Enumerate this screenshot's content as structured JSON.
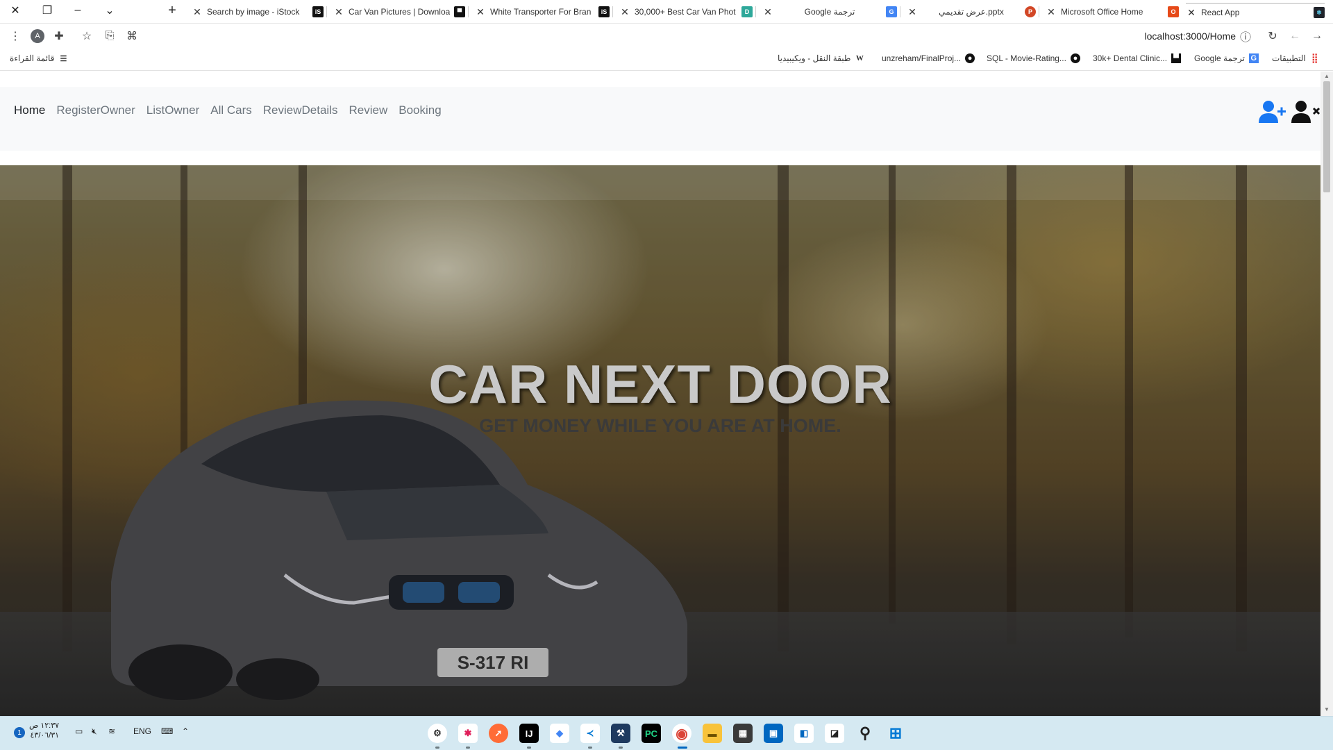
{
  "browser": {
    "tabs": [
      {
        "title": "React App",
        "favicon": "react-icon",
        "active": true
      },
      {
        "title": "Microsoft Office Home",
        "favicon": "office-icon"
      },
      {
        "title": "عرض تقديمي.pptx",
        "favicon": "powerpoint-icon"
      },
      {
        "title": "Google ترجمة",
        "favicon": "google-translate-icon"
      },
      {
        "title": "30,000+ Best Car Van Phot",
        "favicon": "d-icon"
      },
      {
        "title": "White Transporter For Bran",
        "favicon": "istock-icon"
      },
      {
        "title": "Car Van Pictures | Downloa",
        "favicon": "unsplash-icon"
      },
      {
        "title": "Search by image - iStock",
        "favicon": "istock-icon"
      }
    ],
    "new_tab_symbol": "+",
    "url": "localhost:3000/Home",
    "bookmarks": [
      {
        "label": "التطبيقات",
        "icon": "apps-grid-icon"
      },
      {
        "label": "Google ترجمة",
        "icon": "google-translate-icon"
      },
      {
        "label": "30k+ Dental Clinic...",
        "icon": "unsplash-icon"
      },
      {
        "label": "SQL - Movie-Rating...",
        "icon": "github-icon"
      },
      {
        "label": "unzreham/FinalProj...",
        "icon": "github-icon"
      },
      {
        "label": "طبقة النقل - ويكيبيديا",
        "icon": "wikipedia-icon"
      }
    ],
    "reading_list": "قائمة القراءة"
  },
  "navbar": {
    "links": [
      {
        "label": "Home",
        "active": true
      },
      {
        "label": "RegisterOwner"
      },
      {
        "label": "ListOwner"
      },
      {
        "label": "All Cars"
      },
      {
        "label": "ReviewDetails"
      },
      {
        "label": "Review"
      },
      {
        "label": "Booking"
      }
    ]
  },
  "hero": {
    "title": "CAR NEXT DOOR",
    "subtitle": "GET MONEY WHILE YOU ARE AT HOME.",
    "plate": "S-317 RI"
  },
  "taskbar": {
    "language": "ENG",
    "time": "١٢:٣٧ ص",
    "date": "٤٣/٠٦/٣١",
    "notification_count": "1"
  },
  "colors": {
    "nav_icon": "#1877f2",
    "navbar_bg": "#f8f9fa",
    "taskbar_bg": "#d5e9f2"
  }
}
